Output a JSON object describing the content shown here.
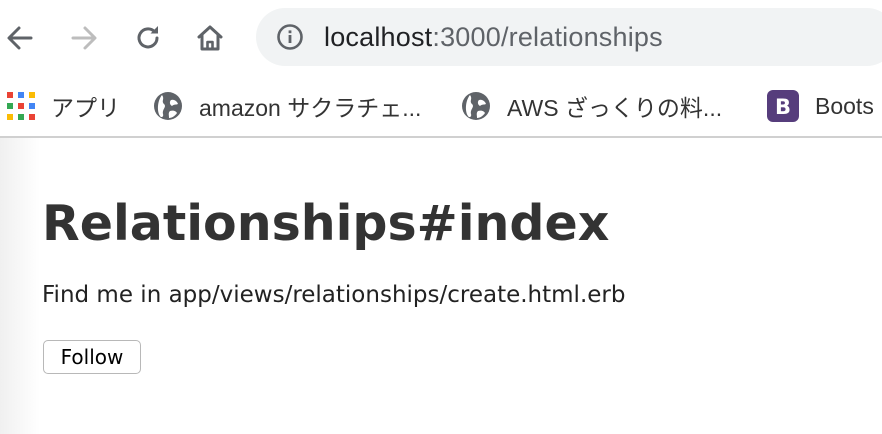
{
  "browser": {
    "url_host": "localhost",
    "url_rest": ":3000/relationships",
    "bookmarks": [
      {
        "label": "アプリ",
        "icon": "apps-grid-icon"
      },
      {
        "label": "amazon サクラチェ...",
        "icon": "globe-icon"
      },
      {
        "label": "AWS ざっくりの料...",
        "icon": "globe-icon"
      },
      {
        "label": "Boots",
        "icon": "bootstrap-icon",
        "icon_text": "B"
      }
    ]
  },
  "page": {
    "title": "Relationships#index",
    "description": "Find me in app/views/relationships/create.html.erb",
    "follow_button": "Follow"
  }
}
